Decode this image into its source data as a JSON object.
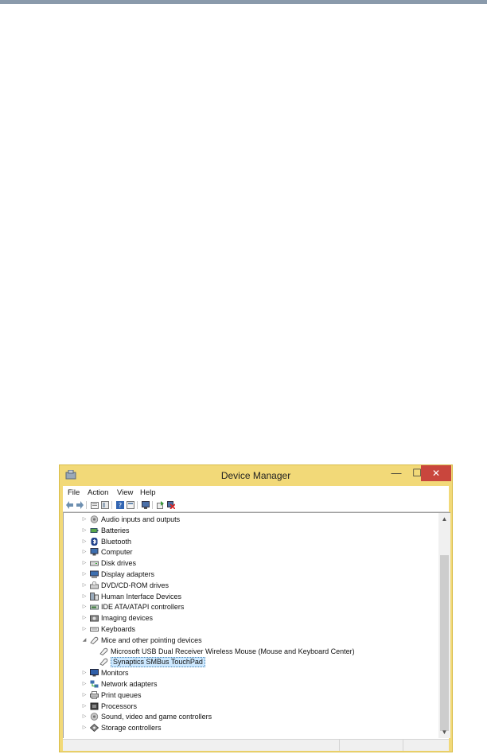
{
  "window": {
    "title": "Device Manager",
    "min_glyph": "—",
    "max_glyph": "☐",
    "close_glyph": "✕",
    "accent_color": "#f2d978",
    "close_color": "#c9463d",
    "selection_color": "#cce8ff"
  },
  "menu": [
    "File",
    "Action",
    "View",
    "Help"
  ],
  "toolbar": [
    "back-icon",
    "forward-icon",
    "properties-icon",
    "show-hide-icon",
    "help-icon",
    "view-icon",
    "monitor-icon",
    "update-driver-icon",
    "uninstall-icon"
  ],
  "tree": [
    {
      "label": "Audio inputs and outputs",
      "expander": "▷",
      "icon": "speaker-icon"
    },
    {
      "label": "Batteries",
      "expander": "▷",
      "icon": "battery-icon"
    },
    {
      "label": "Bluetooth",
      "expander": "▷",
      "icon": "bluetooth-icon"
    },
    {
      "label": "Computer",
      "expander": "▷",
      "icon": "computer-icon"
    },
    {
      "label": "Disk drives",
      "expander": "▷",
      "icon": "disk-drive-icon"
    },
    {
      "label": "Display adapters",
      "expander": "▷",
      "icon": "display-adapter-icon"
    },
    {
      "label": "DVD/CD-ROM drives",
      "expander": "▷",
      "icon": "dvd-drive-icon"
    },
    {
      "label": "Human Interface Devices",
      "expander": "▷",
      "icon": "hid-icon"
    },
    {
      "label": "IDE ATA/ATAPI controllers",
      "expander": "▷",
      "icon": "ide-controller-icon"
    },
    {
      "label": "Imaging devices",
      "expander": "▷",
      "icon": "camera-icon"
    },
    {
      "label": "Keyboards",
      "expander": "▷",
      "icon": "keyboard-icon"
    },
    {
      "label": "Mice and other pointing devices",
      "expander": "◢",
      "icon": "mouse-icon"
    },
    {
      "label": "Microsoft USB Dual Receiver Wireless Mouse (Mouse and Keyboard Center)",
      "expander": "",
      "icon": "mouse-icon",
      "child": true
    },
    {
      "label": "Synaptics SMBus TouchPad",
      "expander": "",
      "icon": "mouse-icon",
      "child": true,
      "selected": true
    },
    {
      "label": "Monitors",
      "expander": "▷",
      "icon": "monitor-icon"
    },
    {
      "label": "Network adapters",
      "expander": "▷",
      "icon": "network-adapter-icon"
    },
    {
      "label": "Print queues",
      "expander": "▷",
      "icon": "printer-icon"
    },
    {
      "label": "Processors",
      "expander": "▷",
      "icon": "processor-icon"
    },
    {
      "label": "Sound, video and game controllers",
      "expander": "▷",
      "icon": "speaker-icon"
    },
    {
      "label": "Storage controllers",
      "expander": "▷",
      "icon": "storage-controller-icon"
    }
  ],
  "scrollbar": {
    "up_glyph": "▲",
    "down_glyph": "▼"
  }
}
